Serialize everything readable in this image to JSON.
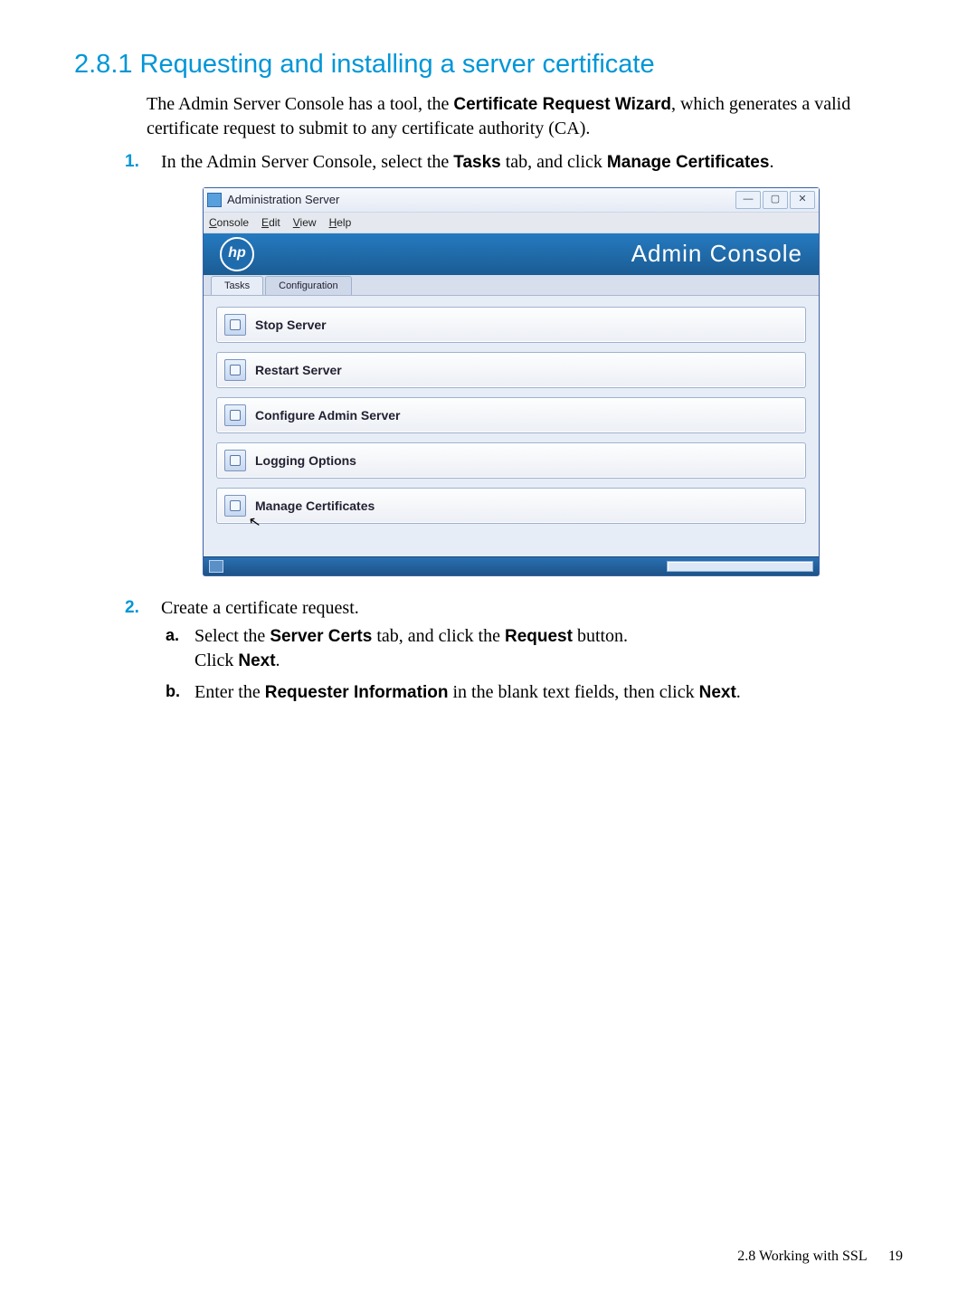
{
  "heading": "2.8.1 Requesting and installing a server certificate",
  "intro": {
    "pre": "The Admin Server Console has a tool, the ",
    "bold1": "Certificate Request Wizard",
    "post": ", which generates a valid certificate request to submit to any certificate authority (CA)."
  },
  "step1": {
    "num": "1.",
    "pre": "In the Admin Server Console, select the ",
    "bold1": "Tasks",
    "mid": " tab, and click ",
    "bold2": "Manage Certificates",
    "post": "."
  },
  "screenshot": {
    "window_title": "Administration Server",
    "win_btn_min": "—",
    "win_btn_max": "▢",
    "win_btn_close": "✕",
    "menus": {
      "console": "Console",
      "edit": "Edit",
      "view": "View",
      "help": "Help"
    },
    "logo_text": "hp",
    "banner_title": "Admin Console",
    "tabs": {
      "tasks": "Tasks",
      "configuration": "Configuration"
    },
    "tasks": [
      "Stop Server",
      "Restart Server",
      "Configure Admin Server",
      "Logging Options",
      "Manage Certificates"
    ]
  },
  "step2": {
    "num": "2.",
    "text": "Create a certificate request.",
    "a": {
      "num": "a.",
      "pre": "Select the ",
      "bold1": "Server Certs",
      "mid": " tab, and click the ",
      "bold2": "Request",
      "post": " button.",
      "line2_pre": "Click ",
      "line2_bold": "Next",
      "line2_post": "."
    },
    "b": {
      "num": "b.",
      "pre": "Enter the ",
      "bold1": "Requester Information",
      "mid": " in the blank text fields, then click ",
      "bold2": "Next",
      "post": "."
    }
  },
  "footer": {
    "section": "2.8 Working with SSL",
    "page": "19"
  }
}
